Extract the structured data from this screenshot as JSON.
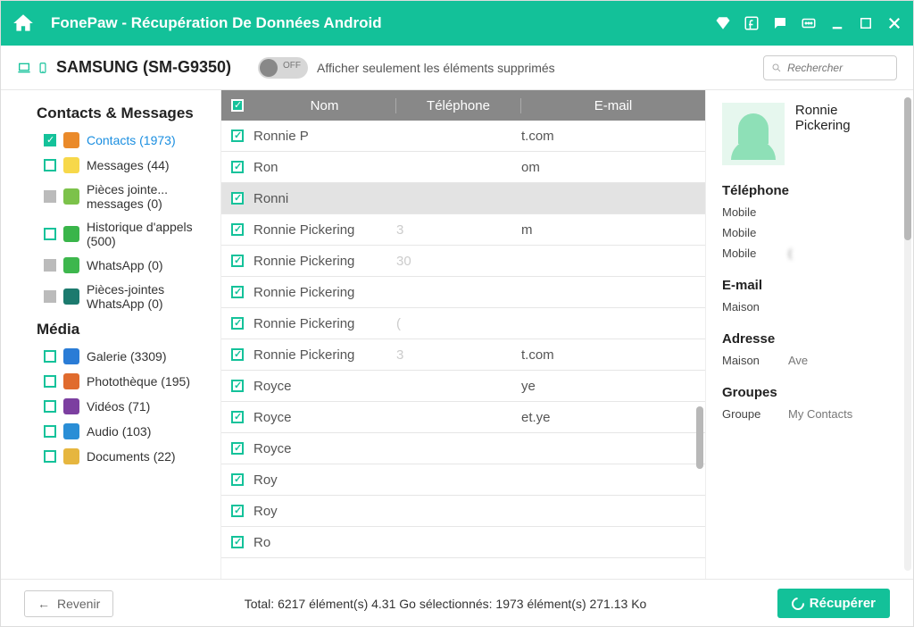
{
  "titlebar": {
    "title": "FonePaw - Récupération De Données Android"
  },
  "toolbar": {
    "device": "SAMSUNG (SM-G9350)",
    "toggle_off": "OFF",
    "toggle_text": "Afficher seulement les éléments supprimés",
    "search_placeholder": "Rechercher"
  },
  "sidebar": {
    "section1": "Contacts & Messages",
    "items1": [
      {
        "label": "Contacts (1973)",
        "checked": true,
        "active": true,
        "iconColor": "#ea8a2a"
      },
      {
        "label": "Messages (44)",
        "checked": false,
        "iconColor": "#f7d84a"
      },
      {
        "label": "Pièces jointe... messages (0)",
        "grey": true,
        "iconColor": "#7cc24a"
      },
      {
        "label": "Historique d'appels (500)",
        "checked": false,
        "iconColor": "#39b54a"
      },
      {
        "label": "WhatsApp (0)",
        "grey": true,
        "iconColor": "#3db74d"
      },
      {
        "label": "Pièces-jointes WhatsApp (0)",
        "grey": true,
        "iconColor": "#1c7a6e"
      }
    ],
    "section2": "Média",
    "items2": [
      {
        "label": "Galerie (3309)",
        "iconColor": "#2a7cd6"
      },
      {
        "label": "Photothèque (195)",
        "iconColor": "#e06b2e"
      },
      {
        "label": "Vidéos (71)",
        "iconColor": "#7c3fa0"
      },
      {
        "label": "Audio (103)",
        "iconColor": "#2a8ed6"
      },
      {
        "label": "Documents (22)",
        "iconColor": "#e6b63f"
      }
    ]
  },
  "table": {
    "headers": {
      "name": "Nom",
      "phone": "Téléphone",
      "email": "E-mail"
    },
    "rows": [
      {
        "name": "Ronnie P",
        "email": "t.com"
      },
      {
        "name": "Ron",
        "email": "om"
      },
      {
        "name": "Ronni",
        "selected": true
      },
      {
        "name": "Ronnie Pickering",
        "phone": "3",
        "email": "m"
      },
      {
        "name": "Ronnie Pickering",
        "phone": "30"
      },
      {
        "name": "Ronnie Pickering"
      },
      {
        "name": "Ronnie Pickering",
        "phone": "("
      },
      {
        "name": "Ronnie Pickering",
        "phone": "3",
        "email": "t.com"
      },
      {
        "name": "Royce",
        "email": "ye"
      },
      {
        "name": "Royce",
        "email": "et.ye"
      },
      {
        "name": "Royce"
      },
      {
        "name": "Roy"
      },
      {
        "name": "Roy"
      },
      {
        "name": "Ro"
      }
    ]
  },
  "details": {
    "name": "Ronnie Pickering",
    "phone_section": "Téléphone",
    "phones": [
      {
        "label": "Mobile",
        "value": ""
      },
      {
        "label": "Mobile",
        "value": ""
      },
      {
        "label": "Mobile",
        "value": "("
      }
    ],
    "email_section": "E-mail",
    "emails": [
      {
        "label": "Maison",
        "value": ""
      }
    ],
    "address_section": "Adresse",
    "addresses": [
      {
        "label": "Maison",
        "value": "Ave"
      }
    ],
    "groups_section": "Groupes",
    "groups": [
      {
        "label": "Groupe",
        "value": "My Contacts"
      }
    ]
  },
  "footer": {
    "back": "Revenir",
    "status": "Total: 6217 élément(s) 4.31 Go    sélectionnés: 1973 élément(s) 271.13 Ko",
    "recover": "Récupérer"
  }
}
